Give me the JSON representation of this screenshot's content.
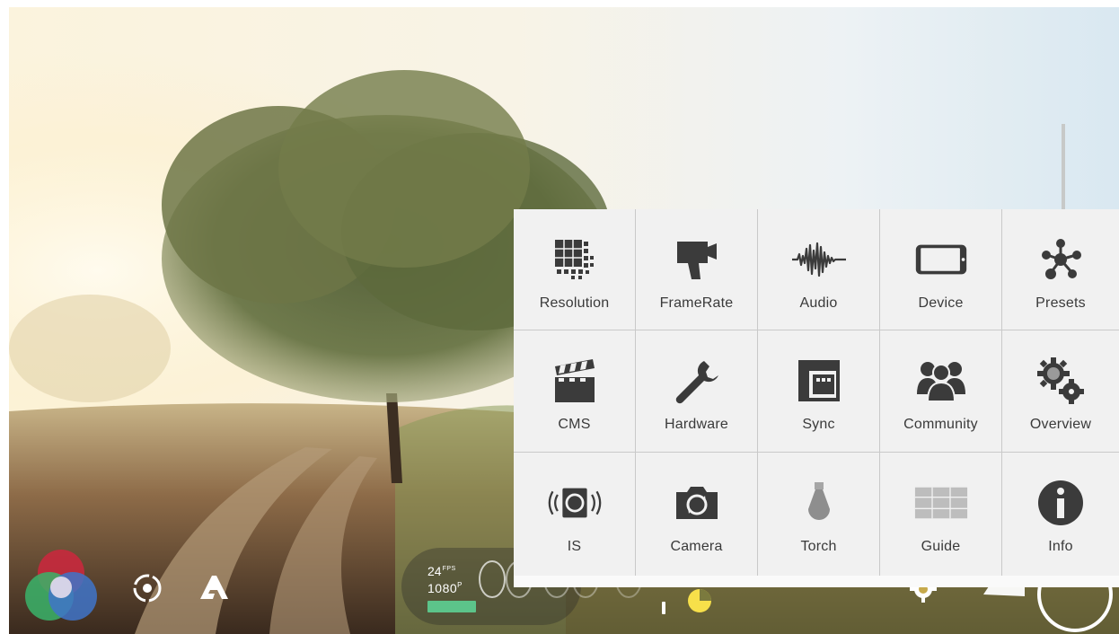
{
  "colors": {
    "menu_bg": "#f1f1f1",
    "divider": "#c9c9c9",
    "label": "#3a3a3a",
    "icon": "#3b3b3b",
    "storage_bar": "#5cc48a",
    "pie_yellow": "#f7e04a"
  },
  "viewfinder": {
    "frame_rate": "24",
    "frame_rate_unit": "FPS",
    "resolution": "1080",
    "resolution_suffix": "P",
    "storage_level": 0.45
  },
  "controls": {
    "color_wheel_icon": "rgb-color-wheel-icon",
    "focus_icon": "focus-target-icon",
    "auto_icon": "auto-a-icon",
    "settings_icon": "gear-icon",
    "chat_icon": "speech-bubble-icon",
    "record_icon": "record-ring-icon"
  },
  "menu": {
    "items": [
      {
        "label": "Resolution",
        "icon": "resolution-grid-icon"
      },
      {
        "label": "FrameRate",
        "icon": "film-camera-icon"
      },
      {
        "label": "Audio",
        "icon": "waveform-icon"
      },
      {
        "label": "Device",
        "icon": "phone-landscape-icon"
      },
      {
        "label": "Presets",
        "icon": "molecule-icon"
      },
      {
        "label": "CMS",
        "icon": "clapperboard-icon"
      },
      {
        "label": "Hardware",
        "icon": "wrench-icon"
      },
      {
        "label": "Sync",
        "icon": "sync-panel-icon"
      },
      {
        "label": "Community",
        "icon": "people-group-icon"
      },
      {
        "label": "Overview",
        "icon": "gears-icon"
      },
      {
        "label": "IS",
        "icon": "stabilization-icon"
      },
      {
        "label": "Camera",
        "icon": "camera-switch-icon"
      },
      {
        "label": "Torch",
        "icon": "bulb-icon"
      },
      {
        "label": "Guide",
        "icon": "guide-grid-icon"
      },
      {
        "label": "Info",
        "icon": "info-icon"
      }
    ]
  }
}
